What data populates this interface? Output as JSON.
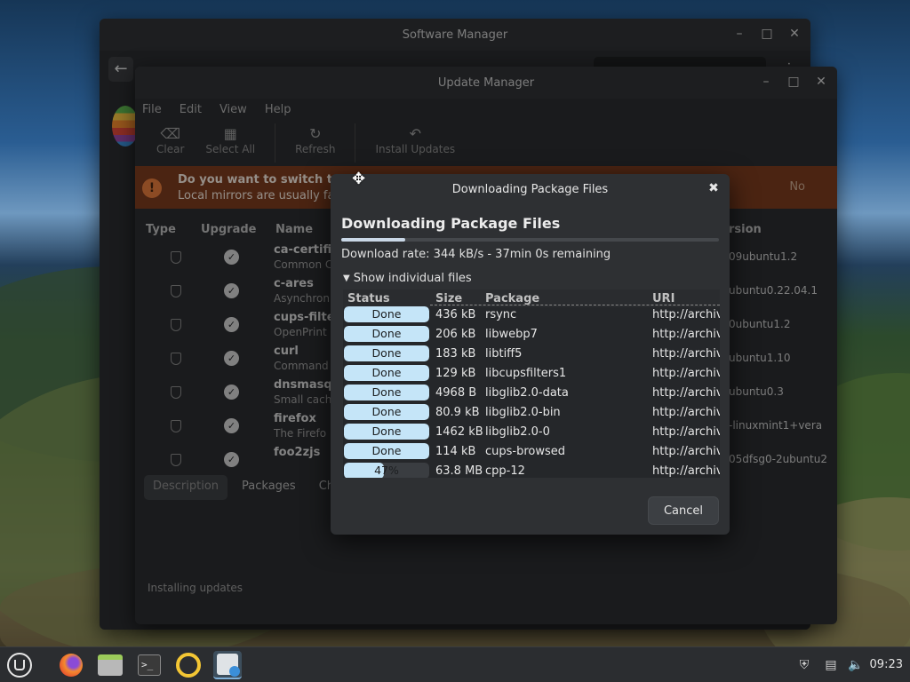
{
  "software_manager": {
    "title": "Software Manager"
  },
  "update_manager": {
    "title": "Update Manager",
    "menu": [
      "File",
      "Edit",
      "View",
      "Help"
    ],
    "toolbar": {
      "clear": "Clear",
      "select_all": "Select All",
      "refresh": "Refresh",
      "install_updates": "Install Updates"
    },
    "banner": {
      "title": "Do you want to switch to a l",
      "subtitle": "Local mirrors are usually fast",
      "no": "No"
    },
    "columns": {
      "type": "Type",
      "upgrade": "Upgrade",
      "name": "Name",
      "version": "rsion"
    },
    "rows": [
      {
        "name": "ca-certific",
        "desc": "Common C",
        "version": "09ubuntu1.2"
      },
      {
        "name": "c-ares",
        "desc": "Asynchron",
        "version": "ubuntu0.22.04.1"
      },
      {
        "name": "cups-filte",
        "desc": "OpenPrint",
        "version": "0ubuntu1.2"
      },
      {
        "name": "curl",
        "desc": "Command",
        "version": "ubuntu1.10"
      },
      {
        "name": "dnsmasq",
        "desc": "Small cach",
        "version": "ubuntu0.3"
      },
      {
        "name": "firefox",
        "desc": "The Firefo",
        "version": "-linuxmint1+vera"
      },
      {
        "name": "foo2zjs",
        "desc": "",
        "version": "05dfsg0-2ubuntu2"
      }
    ],
    "tabs": [
      "Description",
      "Packages",
      "Chan"
    ],
    "status": "Installing updates"
  },
  "dialog": {
    "title": "Downloading Package Files",
    "heading": "Downloading Package Files",
    "overall_progress": 0.17,
    "rate": "Download rate: 344 kB/s - 37min 0s remaining",
    "toggle": "Show individual files",
    "columns": {
      "status": "Status",
      "size": "Size",
      "package": "Package",
      "uri": "URI"
    },
    "files": [
      {
        "status": "Done",
        "progress": 1.0,
        "size": "436 kB",
        "package": "rsync",
        "uri": "http://archiv"
      },
      {
        "status": "Done",
        "progress": 1.0,
        "size": "206 kB",
        "package": "libwebp7",
        "uri": "http://archiv"
      },
      {
        "status": "Done",
        "progress": 1.0,
        "size": "183 kB",
        "package": "libtiff5",
        "uri": "http://archiv"
      },
      {
        "status": "Done",
        "progress": 1.0,
        "size": "129 kB",
        "package": "libcupsfilters1",
        "uri": "http://archiv"
      },
      {
        "status": "Done",
        "progress": 1.0,
        "size": "4968  B",
        "package": "libglib2.0-data",
        "uri": "http://archiv"
      },
      {
        "status": "Done",
        "progress": 1.0,
        "size": "80.9 kB",
        "package": "libglib2.0-bin",
        "uri": "http://archiv"
      },
      {
        "status": "Done",
        "progress": 1.0,
        "size": "1462 kB",
        "package": "libglib2.0-0",
        "uri": "http://archiv"
      },
      {
        "status": "Done",
        "progress": 1.0,
        "size": "114 kB",
        "package": "cups-browsed",
        "uri": "http://archiv"
      },
      {
        "status": "47%",
        "progress": 0.47,
        "size": "63.8 MB",
        "package": "cpp-12",
        "uri": "http://archiv"
      }
    ],
    "cancel": "Cancel"
  },
  "panel": {
    "clock": "09:23"
  }
}
